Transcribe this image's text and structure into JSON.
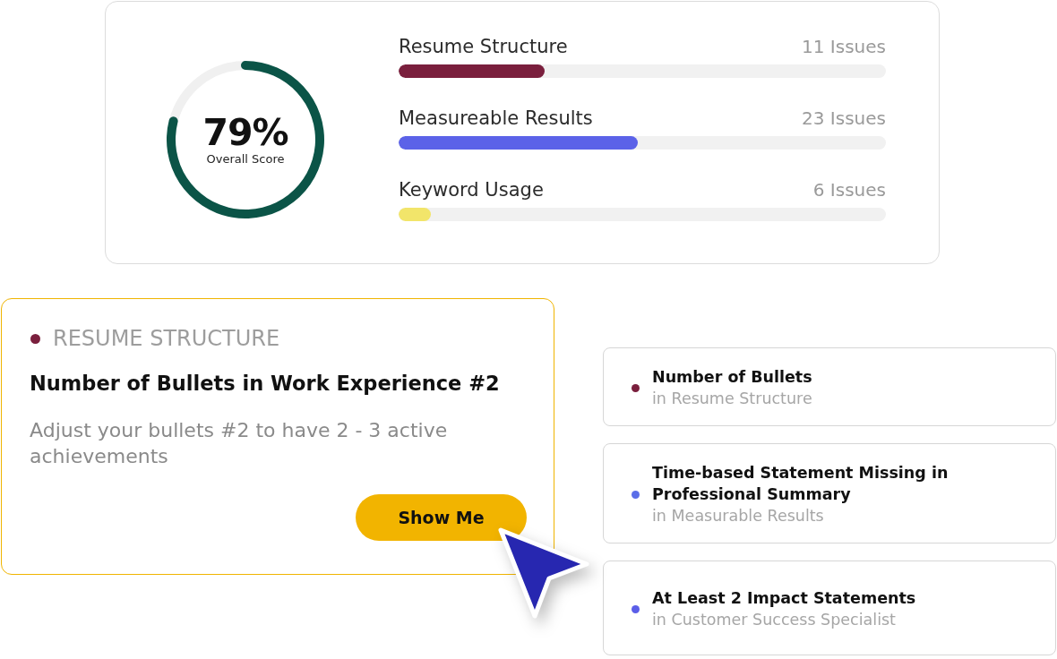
{
  "score_card": {
    "score": {
      "value": "79%",
      "label": "Overall Score"
    },
    "chart_data": [
      {
        "type": "donut",
        "values": [
          79,
          21
        ],
        "colors": [
          "#0b5447",
          "#f0f0f0"
        ]
      }
    ],
    "categories": [
      {
        "name": "Resume Structure",
        "issues": "11 Issues",
        "level": 0.3,
        "color": "#7a1f3d"
      },
      {
        "name": "Measureable Results",
        "issues": "23 Issues",
        "level": 0.49,
        "color": "#5b62e8"
      },
      {
        "name": "Keyword Usage",
        "issues": "6 Issues",
        "level": 0.066,
        "color": "#f2e56a"
      }
    ]
  },
  "issue_detail": {
    "category": {
      "label": "RESUME STRUCTURE",
      "color": "#7a1f3d"
    },
    "title": "Number of Bullets in Work Experience #2",
    "description": "Adjust your bullets #2 to have 2 - 3 active achievements",
    "button": "Show Me"
  },
  "issue_list": [
    {
      "title": "Number of Bullets",
      "location": "in Resume Structure",
      "color": "#7a1f3d"
    },
    {
      "title": "Time-based Statement Missing in Professional Summary",
      "location": "in Measurable Results",
      "color": "#5b6ee8"
    },
    {
      "title": "At Least 2 Impact Statements",
      "location": "in Customer Success Specialist",
      "color": "#5b5ee8"
    }
  ]
}
